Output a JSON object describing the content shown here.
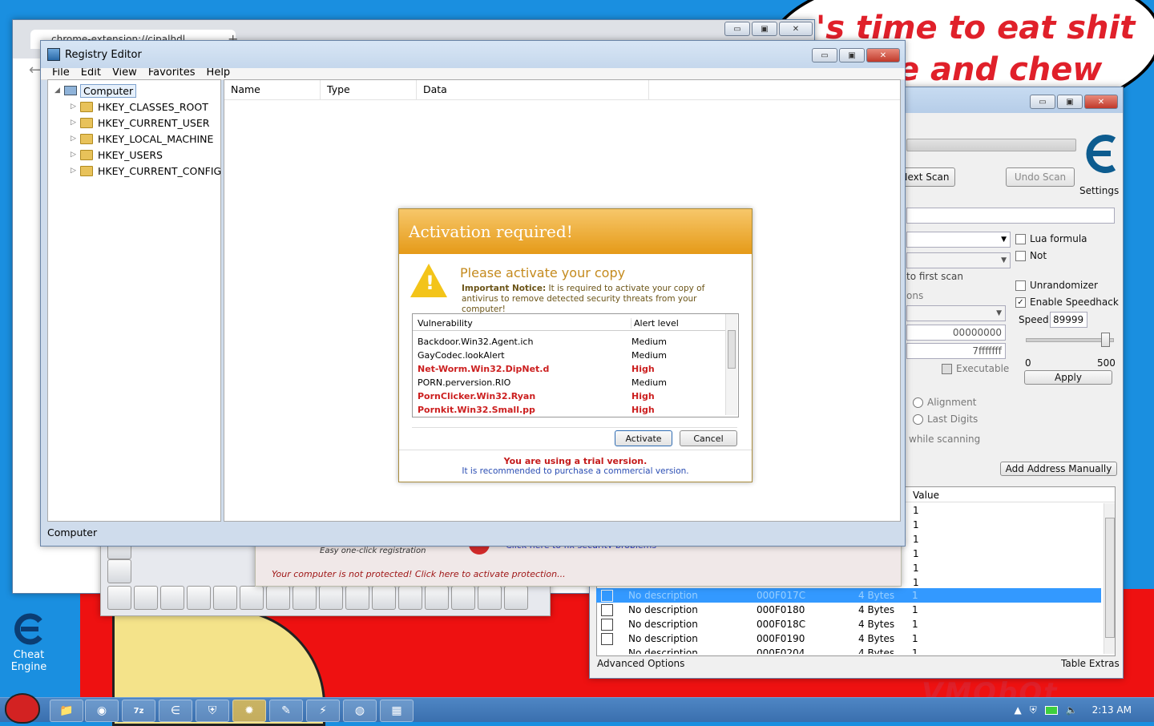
{
  "wallpaper": {
    "line1": "'s time to eat shit",
    "line2": "e and chew",
    "bottom_text": "VMObOt"
  },
  "desktop": {
    "cheat_engine_icon_label_1": "Cheat",
    "cheat_engine_icon_label_2": "Engine"
  },
  "chrome": {
    "tab_title": "chrome-extension://cjpalhdl..."
  },
  "cheat_engine": {
    "next_scan": "Next Scan",
    "undo_scan": "Undo Scan",
    "settings": "Settings",
    "lua_formula": "Lua formula",
    "not": "Not",
    "unrandomizer": "Unrandomizer",
    "enable_speedhack": "Enable Speedhack",
    "speed_label": "Speed",
    "speed_value": "89999",
    "slider_min": "0",
    "slider_max": "500",
    "apply": "Apply",
    "to_first_scan": "to first scan",
    "options_label": "ons",
    "start_addr": "00000000",
    "stop_addr": "7fffffff",
    "executable": "Executable",
    "alignment": "Alignment",
    "last_digits": "Last Digits",
    "while_scanning": "while scanning",
    "add_address_manually": "Add Address Manually",
    "value_header": "Value",
    "value_column": [
      "1",
      "1",
      "1",
      "1",
      "1",
      "1"
    ],
    "rows": [
      {
        "desc": "No description",
        "addr": "000F017C",
        "type": "4 Bytes",
        "value": "1",
        "selected": true
      },
      {
        "desc": "No description",
        "addr": "000F0180",
        "type": "4 Bytes",
        "value": "1",
        "selected": false
      },
      {
        "desc": "No description",
        "addr": "000F018C",
        "type": "4 Bytes",
        "value": "1",
        "selected": false
      },
      {
        "desc": "No description",
        "addr": "000F0190",
        "type": "4 Bytes",
        "value": "1",
        "selected": false
      },
      {
        "desc": "No description",
        "addr": "000F0204",
        "type": "4 Bytes",
        "value": "1",
        "selected": false
      }
    ],
    "advanced_options": "Advanced Options",
    "table_extras": "Table Extras"
  },
  "antivirus": {
    "easy_registration": "Easy one-click registration",
    "fix_link": "Click here to fix security problems",
    "not_protected": "Your computer is not protected! Click here to activate protection..."
  },
  "registry": {
    "title": "Registry Editor",
    "menu": [
      "File",
      "Edit",
      "View",
      "Favorites",
      "Help"
    ],
    "root": "Computer",
    "keys": [
      "HKEY_CLASSES_ROOT",
      "HKEY_CURRENT_USER",
      "HKEY_LOCAL_MACHINE",
      "HKEY_USERS",
      "HKEY_CURRENT_CONFIG"
    ],
    "columns": [
      "Name",
      "Type",
      "Data"
    ],
    "status": "Computer"
  },
  "activation": {
    "title": "Activation required!",
    "heading": "Please activate your copy",
    "notice_bold": "Important Notice:",
    "notice_text": " It is required to activate your copy of antivirus to remove detected security threats from your computer!",
    "col_vulnerability": "Vulnerability",
    "col_alert": "Alert level",
    "threats": [
      {
        "name": "Backdoor.Win32.Agent.ich",
        "level": "Medium",
        "high": false
      },
      {
        "name": "GayCodec.lookAlert",
        "level": "Medium",
        "high": false
      },
      {
        "name": "Net-Worm.Win32.DipNet.d",
        "level": "High",
        "high": true
      },
      {
        "name": "PORN.perversion.RIO",
        "level": "Medium",
        "high": false
      },
      {
        "name": "PornClicker.Win32.Ryan",
        "level": "High",
        "high": true
      },
      {
        "name": "Pornkit.Win32.Small.pp",
        "level": "High",
        "high": true
      }
    ],
    "activate": "Activate",
    "cancel": "Cancel",
    "trial": "You are using a trial version.",
    "recommend": "It is recommended to purchase a commercial version."
  },
  "taskbar": {
    "clock": "2:13 AM"
  },
  "colors": {
    "desktop": "#1a8fe0",
    "dialog_header": "#e59a18",
    "threat_high": "#cc1f1f",
    "selection": "#3399ff"
  }
}
